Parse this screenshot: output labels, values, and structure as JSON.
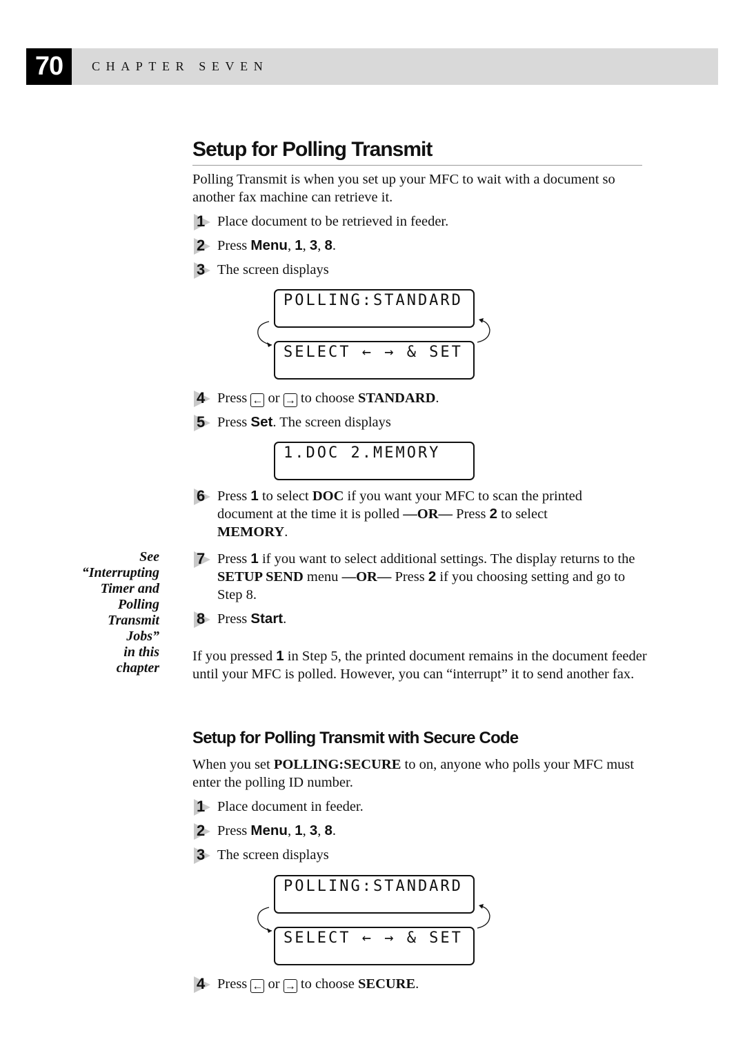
{
  "header": {
    "page_number": "70",
    "chapter": "CHAPTER SEVEN"
  },
  "section1": {
    "title": "Setup for Polling Transmit",
    "intro": "Polling Transmit is when you set up your MFC to wait with a document so another fax machine can retrieve it.",
    "steps": [
      {
        "num": "1",
        "text": "Place document to be retrieved in feeder."
      },
      {
        "num": "2",
        "pre": "Press ",
        "menu": "Menu",
        "sep1": ", ",
        "k1": "1",
        "sep2": ", ",
        "k2": "3",
        "sep3": ", ",
        "k3": "8",
        "post": "."
      },
      {
        "num": "3",
        "text": "The screen displays"
      },
      {
        "num": "4",
        "pre": "Press ",
        "left_key": "←",
        "mid": " or ",
        "right_key": "→",
        "post": " to choose ",
        "bold": "STANDARD",
        "end": "."
      },
      {
        "num": "5",
        "pre": "Press ",
        "bold": "Set",
        "post": ". The screen displays"
      },
      {
        "num": "6",
        "a": "Press ",
        "b1": "1",
        "c": " to select ",
        "b2": "DOC",
        "d": " if you want your MFC to scan the printed document at the time it is polled ",
        "b3": "—OR—",
        "e": " Press ",
        "b4": "2",
        "f": " to select ",
        "b5": "MEMORY",
        "g": "."
      },
      {
        "num": "7",
        "a": "Press ",
        "b1": "1",
        "c": " if you want to select additional settings. The display returns to the ",
        "b2": "SETUP SEND",
        "d": " menu ",
        "b3": "—OR—",
        "e": " Press ",
        "b4": "2",
        "f": " if you choosing setting and go to Step 8."
      },
      {
        "num": "8",
        "pre": "Press ",
        "bold": "Start",
        "post": "."
      }
    ],
    "lcd_cycle": {
      "line1": "POLLING:STANDARD",
      "line2": "SELECT ← → & SET"
    },
    "lcd_doc": "1.DOC 2.MEMORY",
    "after": {
      "a": "If you pressed ",
      "b": "1",
      "c": " in Step 5, the printed document remains in the document feeder until your MFC is polled. However, you can “interrupt” it to send another fax."
    }
  },
  "margin_note": [
    "See",
    "“Interrupting",
    "Timer and",
    "Polling",
    "Transmit",
    "Jobs”",
    "in this",
    "chapter"
  ],
  "section2": {
    "title": "Setup for Polling Transmit with Secure Code",
    "intro": {
      "a": "When you set ",
      "b": "POLLING:SECURE",
      "c": " to on, anyone who polls your MFC must enter the polling ID number."
    },
    "steps": [
      {
        "num": "1",
        "text": "Place document in feeder."
      },
      {
        "num": "2",
        "pre": "Press ",
        "menu": "Menu",
        "sep1": ", ",
        "k1": "1",
        "sep2": ", ",
        "k2": "3",
        "sep3": ", ",
        "k3": "8",
        "post": "."
      },
      {
        "num": "3",
        "text": "The screen displays"
      },
      {
        "num": "4",
        "pre": "Press ",
        "left_key": "←",
        "mid": " or ",
        "right_key": "→",
        "post": " to choose ",
        "bold": "SECURE",
        "end": "."
      }
    ],
    "lcd_cycle": {
      "line1": "POLLING:STANDARD",
      "line2": "SELECT ← → & SET"
    }
  }
}
